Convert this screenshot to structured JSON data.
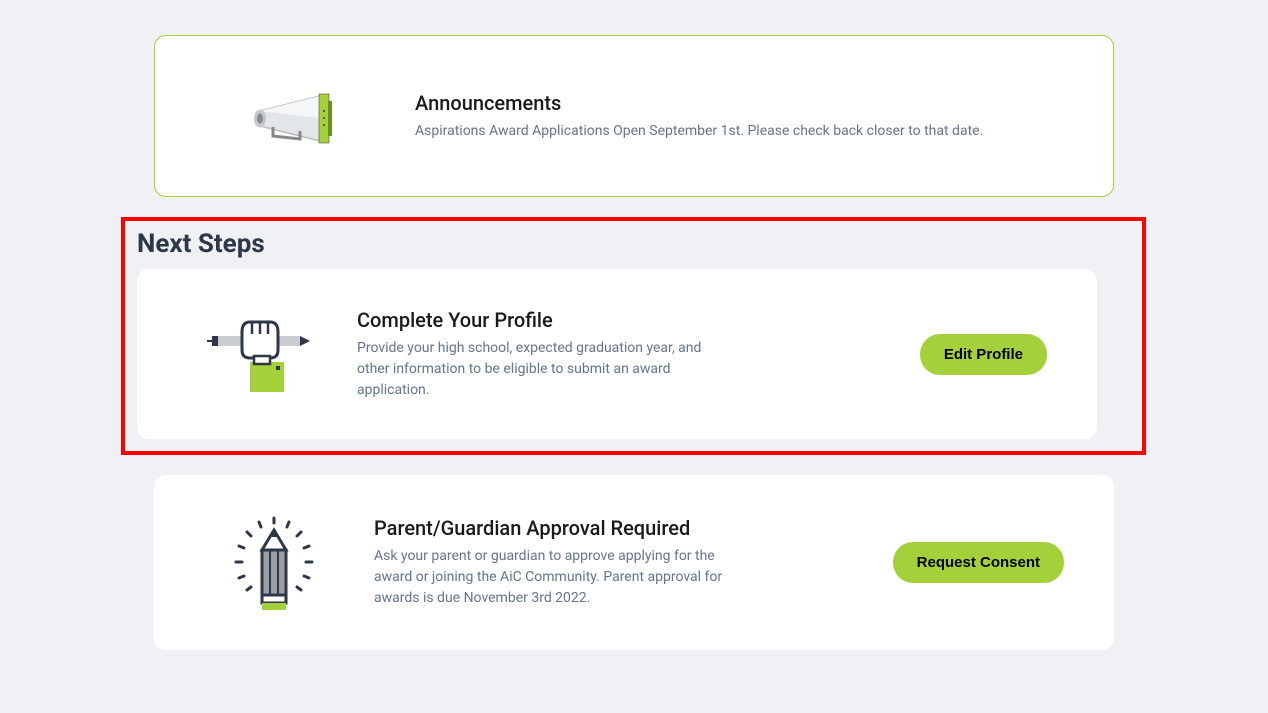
{
  "announcements": {
    "title": "Announcements",
    "description": "Aspirations Award Applications Open September 1st. Please check back closer to that date."
  },
  "section_title": "Next Steps",
  "steps": [
    {
      "title": "Complete Your Profile",
      "description": "Provide your high school, expected graduation year, and other information to be eligible to submit an award application.",
      "button_label": "Edit Profile"
    },
    {
      "title": "Parent/Guardian Approval Required",
      "description": "Ask your parent or guardian to approve applying for the award or joining the AiC Community. Parent approval for awards is due November 3rd 2022.",
      "button_label": "Request Consent"
    }
  ],
  "colors": {
    "accent": "#a4d13a",
    "highlight_border": "#ff0000",
    "background": "#f0f1f4",
    "muted_text": "#64748b"
  }
}
